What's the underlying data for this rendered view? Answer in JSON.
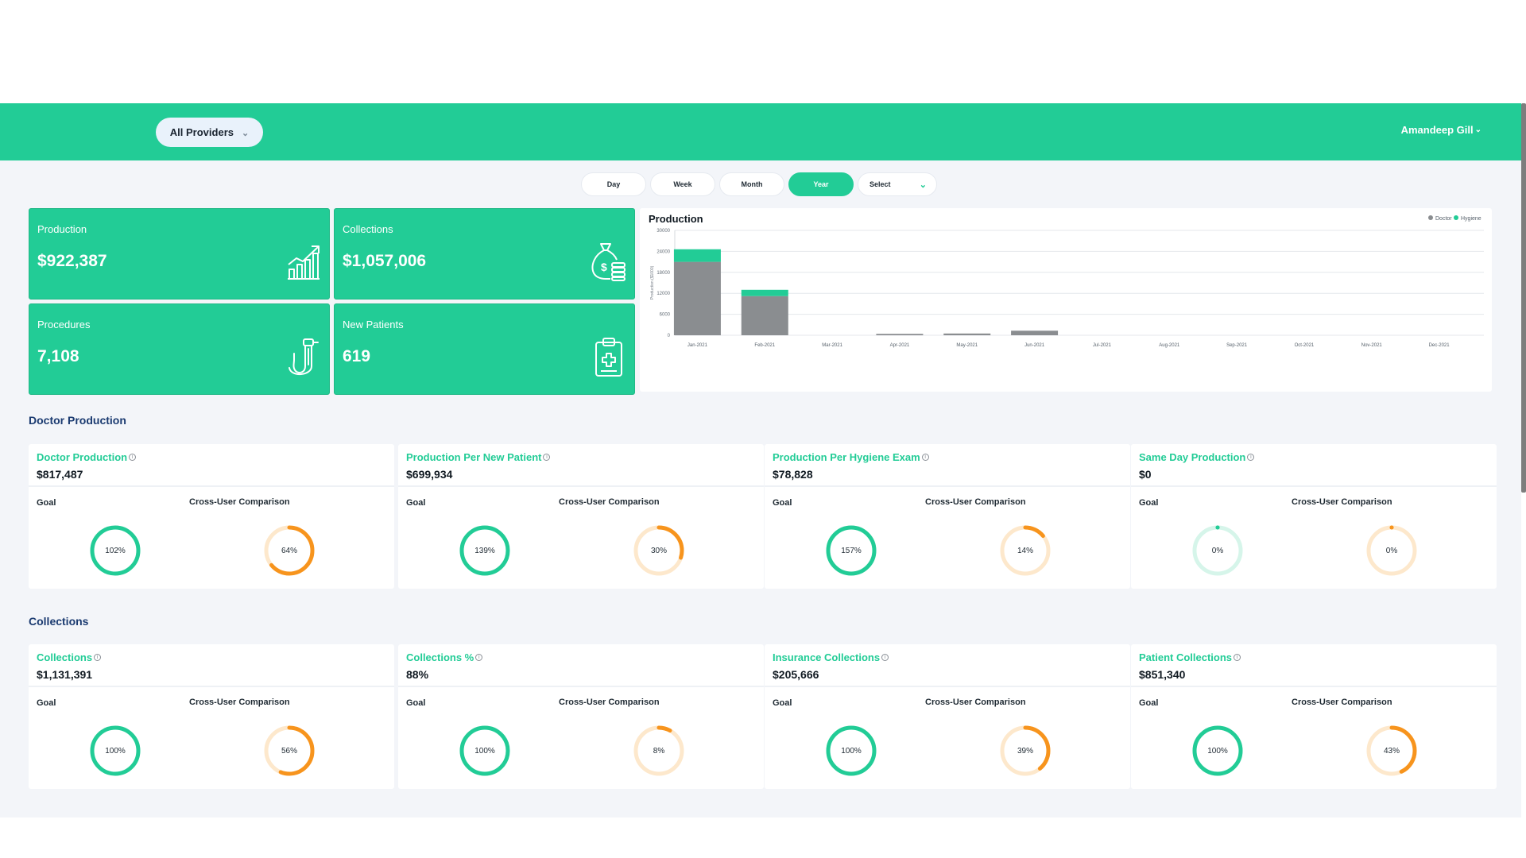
{
  "header": {
    "provider_filter": "All Providers",
    "user_name": "Amandeep Gill"
  },
  "periods": [
    {
      "label": "Day",
      "active": false
    },
    {
      "label": "Week",
      "active": false
    },
    {
      "label": "Month",
      "active": false
    },
    {
      "label": "Year",
      "active": true
    }
  ],
  "period_select": "Select",
  "stats": [
    {
      "label": "Production",
      "value": "$922,387",
      "icon": "growth-chart-icon"
    },
    {
      "label": "Collections",
      "value": "$1,057,006",
      "icon": "money-bag-coins-icon"
    },
    {
      "label": "Procedures",
      "value": "7,108",
      "icon": "dental-tool-icon"
    },
    {
      "label": "New Patients",
      "value": "619",
      "icon": "clipboard-medical-icon"
    }
  ],
  "chart_data": {
    "type": "bar",
    "stacked": true,
    "title": "Production",
    "ylabel": "Production ($1000)",
    "ylim": [
      0,
      30000
    ],
    "yticks": [
      0,
      6000,
      12000,
      18000,
      24000,
      30000
    ],
    "categories": [
      "Jan-2021",
      "Feb-2021",
      "Mar-2021",
      "Apr-2021",
      "May-2021",
      "Jun-2021",
      "Jul-2021",
      "Aug-2021",
      "Sep-2021",
      "Oct-2021",
      "Nov-2021",
      "Dec-2021"
    ],
    "series": [
      {
        "name": "Doctor",
        "color": "#8a8d90",
        "values": [
          21000,
          11200,
          0,
          400,
          500,
          1300,
          0,
          0,
          0,
          0,
          0,
          0
        ]
      },
      {
        "name": "Hygiene",
        "color": "#22cc96",
        "values": [
          3600,
          1800,
          0,
          0,
          0,
          0,
          0,
          0,
          0,
          0,
          0,
          0
        ]
      }
    ],
    "legend": "top-right",
    "grid": true
  },
  "sections": [
    {
      "title": "Doctor Production",
      "kpis": [
        {
          "title": "Doctor Production",
          "value": "$817,487",
          "goal": 102,
          "goal_text": "102%",
          "comparison": 64,
          "comparison_text": "64%"
        },
        {
          "title": "Production Per New Patient",
          "value": "$699,934",
          "goal": 139,
          "goal_text": "139%",
          "comparison": 30,
          "comparison_text": "30%"
        },
        {
          "title": "Production Per Hygiene Exam",
          "value": "$78,828",
          "goal": 157,
          "goal_text": "157%",
          "comparison": 14,
          "comparison_text": "14%"
        },
        {
          "title": "Same Day Production",
          "value": "$0",
          "goal": 0,
          "goal_text": "0%",
          "comparison": 0,
          "comparison_text": "0%"
        }
      ]
    },
    {
      "title": "Collections",
      "kpis": [
        {
          "title": "Collections",
          "value": "$1,131,391",
          "goal": 100,
          "goal_text": "100%",
          "comparison": 56,
          "comparison_text": "56%"
        },
        {
          "title": "Collections %",
          "value": "88%",
          "goal": 100,
          "goal_text": "100%",
          "comparison": 8,
          "comparison_text": "8%"
        },
        {
          "title": "Insurance Collections",
          "value": "$205,666",
          "goal": 100,
          "goal_text": "100%",
          "comparison": 39,
          "comparison_text": "39%"
        },
        {
          "title": "Patient Collections",
          "value": "$851,340",
          "goal": 100,
          "goal_text": "100%",
          "comparison": 43,
          "comparison_text": "43%"
        }
      ]
    }
  ],
  "labels": {
    "goal": "Goal",
    "comparison": "Cross-User Comparison"
  },
  "colors": {
    "brand": "#22cc96",
    "goal_ring": "#22cc96",
    "goal_track": "#d6f5ea",
    "comparison_ring": "#f7941d",
    "comparison_track": "#fde8cc",
    "section_title": "#1a3a70"
  }
}
